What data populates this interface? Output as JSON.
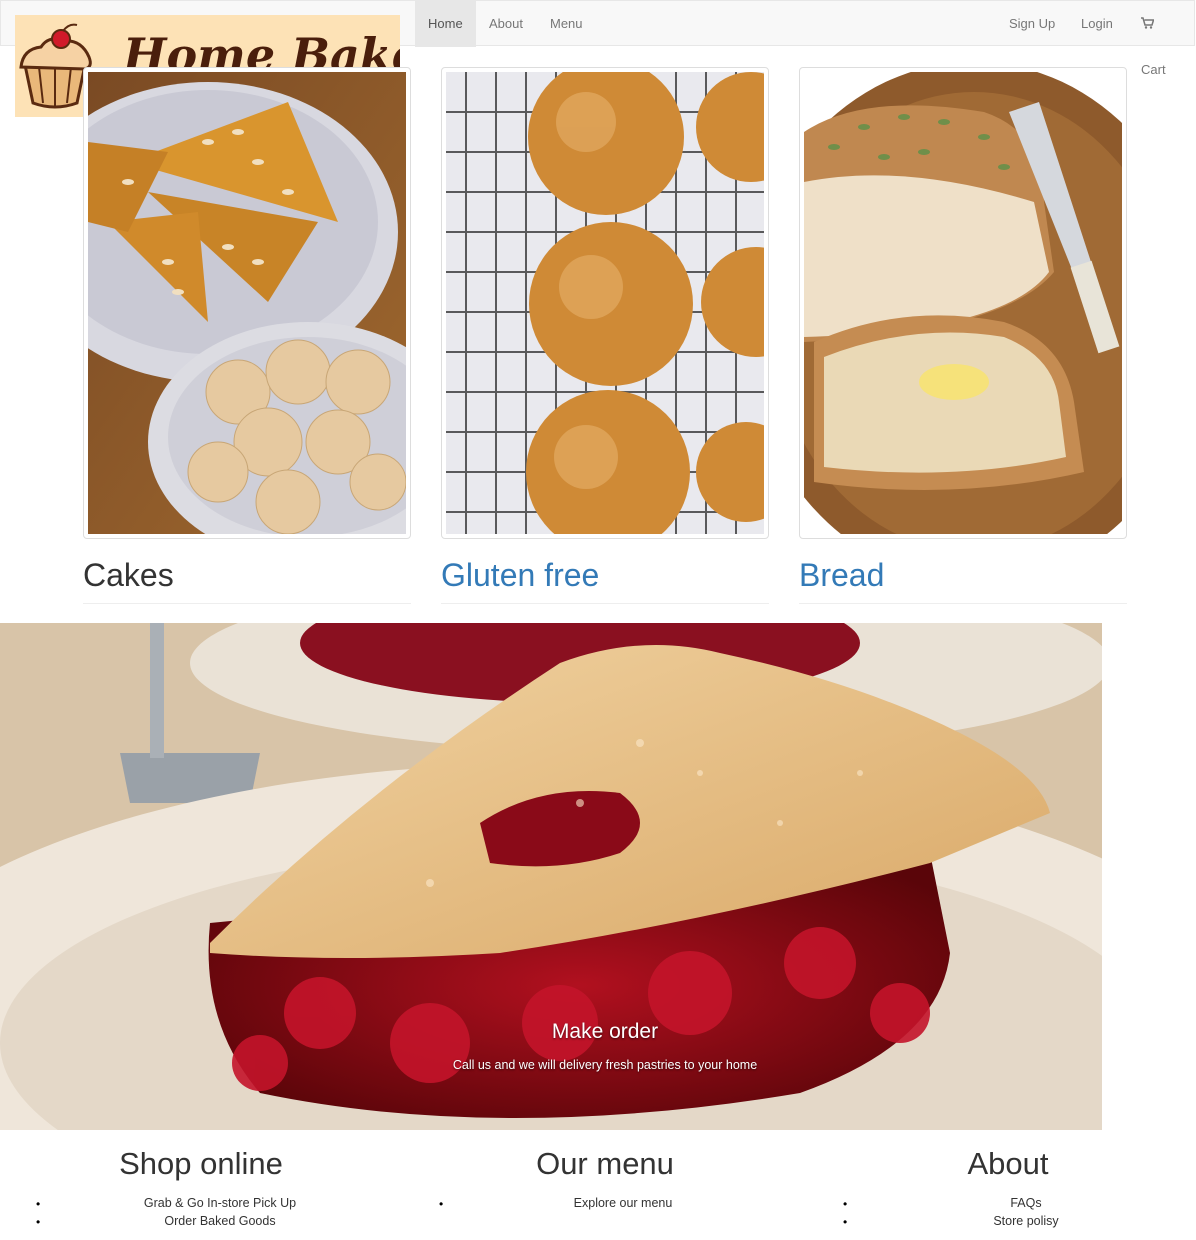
{
  "brand": {
    "logo_text": "Home Bakery"
  },
  "nav": {
    "left": [
      "Home",
      "About",
      "Menu"
    ],
    "active": "Home",
    "sign_up": "Sign Up",
    "login": "Login",
    "cart": "Cart"
  },
  "categories": [
    {
      "title": "Cakes"
    },
    {
      "title": "Gluten free"
    },
    {
      "title": "Bread"
    }
  ],
  "hero": {
    "title": "Make order",
    "subtitle": "Call us and we will delivery fresh pastries to your home"
  },
  "footer": {
    "shop": {
      "heading": "Shop online",
      "items": [
        "Grab & Go In-store Pick Up",
        "Order Baked Goods"
      ]
    },
    "menu": {
      "heading": "Our menu",
      "items": [
        "Explore our menu"
      ]
    },
    "about": {
      "heading": "About",
      "items": [
        "FAQs",
        "Store polisy"
      ]
    }
  },
  "colors": {
    "link": "#337ab7",
    "navbar_bg": "#f8f8f8",
    "logo_bg": "#fde2b6"
  }
}
